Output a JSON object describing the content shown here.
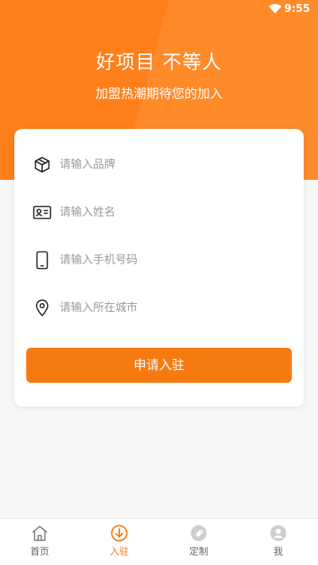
{
  "status_bar": {
    "time": "9:55"
  },
  "hero": {
    "title": "好项目 不等人",
    "subtitle": "加盟热潮期待您的加入"
  },
  "form": {
    "fields": [
      {
        "placeholder": "请输入品牌",
        "icon": "box-icon"
      },
      {
        "placeholder": "请输入姓名",
        "icon": "id-card-icon"
      },
      {
        "placeholder": "请输入手机号码",
        "icon": "phone-icon"
      },
      {
        "placeholder": "请输入所在城市",
        "icon": "location-pin-icon"
      }
    ],
    "submit_label": "申请入驻"
  },
  "tabbar": {
    "items": [
      {
        "label": "首页",
        "icon": "home-icon",
        "active": false
      },
      {
        "label": "入驻",
        "icon": "download-circle-icon",
        "active": true
      },
      {
        "label": "定制",
        "icon": "tag-icon",
        "active": false
      },
      {
        "label": "我",
        "icon": "user-icon",
        "active": false
      }
    ]
  },
  "colors": {
    "accent": "#f57a10",
    "hero_bg": "#ff7f1a",
    "page_bg": "#f7f7f7",
    "placeholder": "#9a9a9a"
  }
}
